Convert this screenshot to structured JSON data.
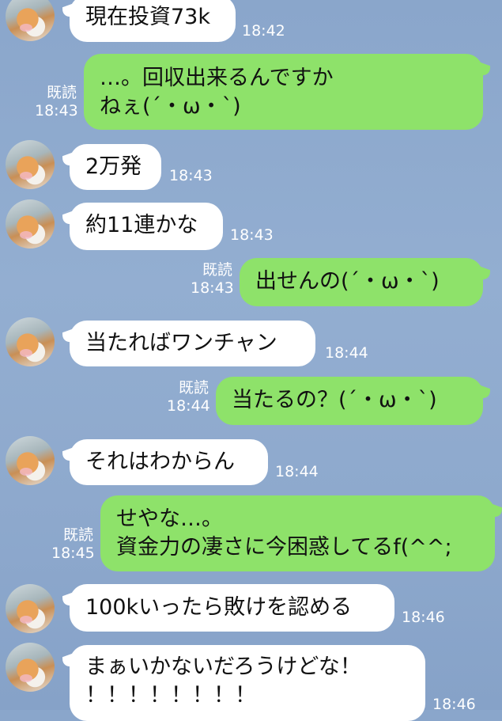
{
  "read_label": "既読",
  "messages": [
    {
      "side": "in",
      "lines": [
        "現在投資73k"
      ],
      "time": "18:42"
    },
    {
      "side": "out",
      "lines": [
        "…。回収出来るんですか",
        "ねぇ(´・ω・`)"
      ],
      "time": "18:43",
      "read": "既読"
    },
    {
      "side": "in",
      "lines": [
        "2万発"
      ],
      "time": "18:43"
    },
    {
      "side": "in",
      "lines": [
        "約11連かな"
      ],
      "time": "18:43"
    },
    {
      "side": "out",
      "lines": [
        "出せんの(´・ω・`)"
      ],
      "time": "18:43",
      "read": "既読"
    },
    {
      "side": "in",
      "lines": [
        "当たればワンチャン"
      ],
      "time": "18:44"
    },
    {
      "side": "out",
      "lines": [
        "当たるの？(´・ω・`)"
      ],
      "time": "18:44",
      "read": "既読"
    },
    {
      "side": "in",
      "lines": [
        "それはわからん"
      ],
      "time": "18:44"
    },
    {
      "side": "out",
      "lines": [
        "せやな…。",
        "資金力の凄さに今困惑してるf(^^;"
      ],
      "time": "18:45",
      "read": "既読"
    },
    {
      "side": "in",
      "lines": [
        "100kいったら敗けを認める"
      ],
      "time": "18:46"
    },
    {
      "side": "in",
      "lines": [
        "まぁいかないだろうけどな！",
        "！！！！！！！！"
      ],
      "time": "18:46"
    }
  ]
}
